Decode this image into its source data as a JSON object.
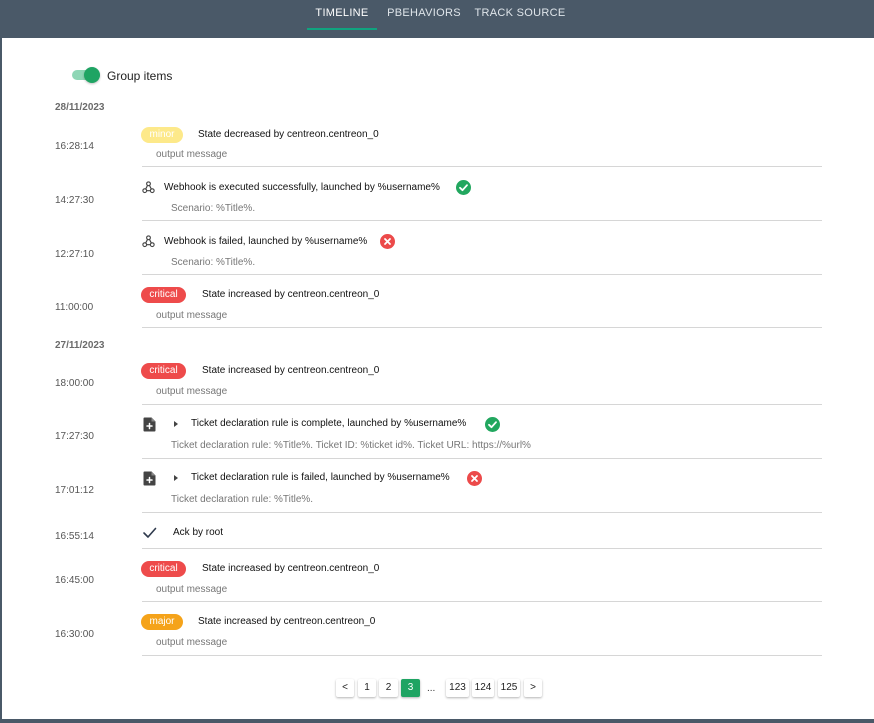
{
  "tabs": [
    {
      "label": "TIMELINE",
      "active": true
    },
    {
      "label": "PBEHAVIORS",
      "active": false
    },
    {
      "label": "TRACK SOURCE",
      "active": false
    }
  ],
  "group_toggle": {
    "label": "Group items",
    "on": true
  },
  "groups": [
    {
      "date": "28/11/2023"
    },
    {
      "date": "27/11/2023"
    }
  ],
  "entries": [
    {
      "time": "16:28:14",
      "badge": "minor",
      "title": "State decreased by centreon.centreon_0",
      "sub": "output message"
    },
    {
      "time": "14:27:30",
      "icon": "webhook-icon",
      "title": "Webhook is executed successfully, launched by %username%",
      "status": "success",
      "sub": "Scenario: %Title%."
    },
    {
      "time": "12:27:10",
      "icon": "webhook-icon",
      "title": "Webhook is failed, launched by %username%",
      "status": "fail",
      "sub": "Scenario: %Title%."
    },
    {
      "time": "11:00:00",
      "badge": "critical",
      "title": "State increased by centreon.centreon_0",
      "sub": "output message"
    },
    {
      "time": "18:00:00",
      "badge": "critical",
      "title": "State increased by centreon.centreon_0",
      "sub": "output message"
    },
    {
      "time": "17:27:30",
      "icon": "file-add-icon",
      "title": "Ticket declaration rule is complete, launched by %username%",
      "status": "success",
      "sub": "Ticket declaration rule: %Title%. Ticket ID: %ticket id%. Ticket URL: https://%url%"
    },
    {
      "time": "17:01:12",
      "icon": "file-add-icon",
      "title": "Ticket declaration rule is failed, launched by %username%",
      "status": "fail",
      "sub": "Ticket declaration rule: %Title%."
    },
    {
      "time": "16:55:14",
      "icon": "check-icon",
      "title": "Ack by root"
    },
    {
      "time": "16:45:00",
      "badge": "critical",
      "title": "State increased by centreon.centreon_0",
      "sub": "output message"
    },
    {
      "time": "16:30:00",
      "badge": "major",
      "title": "State increased by centreon.centreon_0",
      "sub": "output message"
    }
  ],
  "pagination": {
    "prev": "<",
    "next": ">",
    "pages": [
      "1",
      "2",
      "3",
      "123",
      "124",
      "125"
    ],
    "current": "3",
    "ellipsis": "..."
  },
  "colors": {
    "accent": "#1fa463",
    "minor": "#fde98a",
    "critical": "#ee4b4b",
    "major": "#f5a31a",
    "header_bg": "#4a5968"
  }
}
